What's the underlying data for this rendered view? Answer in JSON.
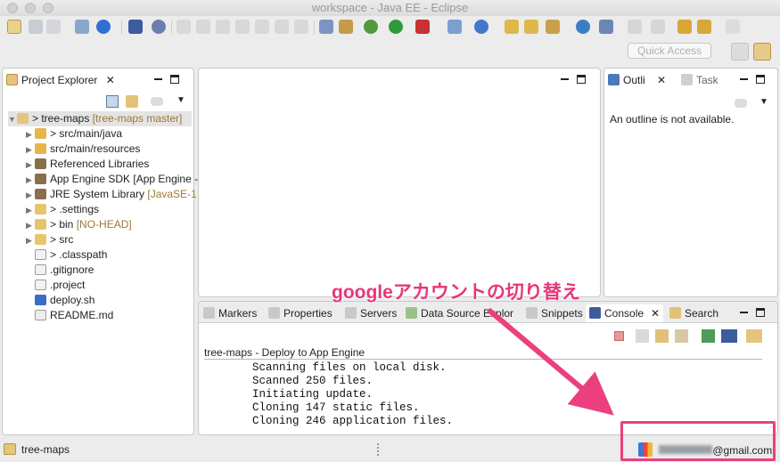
{
  "window": {
    "title": "workspace - Java EE - Eclipse"
  },
  "toolbar": {
    "quick_access_placeholder": "Quick Access"
  },
  "project_explorer": {
    "tab_label": "Project Explorer",
    "tree": [
      {
        "label": "> tree-maps",
        "decoration": " [tree-maps master]",
        "indent": 0,
        "expanded": true,
        "icon": "project-icon"
      },
      {
        "label": "> src/main/java",
        "decoration": "",
        "indent": 1,
        "expanded": false,
        "icon": "source-folder-icon"
      },
      {
        "label": "src/main/resources",
        "decoration": "",
        "indent": 1,
        "expanded": false,
        "icon": "source-folder-icon"
      },
      {
        "label": "Referenced Libraries",
        "decoration": "",
        "indent": 1,
        "expanded": false,
        "icon": "library-icon"
      },
      {
        "label": "App Engine SDK [App Engine -",
        "decoration": "",
        "indent": 1,
        "expanded": false,
        "icon": "library-icon"
      },
      {
        "label": "JRE System Library",
        "decoration": " [JavaSE-1",
        "indent": 1,
        "expanded": false,
        "icon": "library-icon"
      },
      {
        "label": "> .settings",
        "decoration": "",
        "indent": 1,
        "expanded": false,
        "icon": "folder-icon"
      },
      {
        "label": "> bin",
        "decoration": " [NO-HEAD]",
        "indent": 1,
        "expanded": false,
        "icon": "folder-icon"
      },
      {
        "label": "> src",
        "decoration": "",
        "indent": 1,
        "expanded": false,
        "icon": "folder-icon"
      },
      {
        "label": "> .classpath",
        "decoration": "",
        "indent": 1,
        "expanded": null,
        "icon": "file-icon"
      },
      {
        "label": ".gitignore",
        "decoration": "",
        "indent": 1,
        "expanded": null,
        "icon": "file-icon"
      },
      {
        "label": ".project",
        "decoration": "",
        "indent": 1,
        "expanded": null,
        "icon": "file-icon"
      },
      {
        "label": "deploy.sh",
        "decoration": "",
        "indent": 1,
        "expanded": null,
        "icon": "script-icon"
      },
      {
        "label": "README.md",
        "decoration": "",
        "indent": 1,
        "expanded": null,
        "icon": "text-file-icon"
      }
    ]
  },
  "outline": {
    "tabs": [
      {
        "label": "Outli",
        "active": true
      },
      {
        "label": "Task",
        "active": false
      }
    ],
    "message": "An outline is not available."
  },
  "bottom_panel": {
    "tabs": [
      {
        "label": "Markers",
        "active": false
      },
      {
        "label": "Properties",
        "active": false
      },
      {
        "label": "Servers",
        "active": false
      },
      {
        "label": "Data Source Explor",
        "active": false
      },
      {
        "label": "Snippets",
        "active": false
      },
      {
        "label": "Console",
        "active": true
      },
      {
        "label": "Search",
        "active": false
      }
    ],
    "console_title": "tree-maps - Deploy to App Engine",
    "console_lines": [
      "Scanning files on local disk.",
      "Scanned 250 files.",
      "Initiating update.",
      "Cloning 147 static files.",
      "Cloning 246 application files."
    ]
  },
  "status_bar": {
    "project": "tree-maps",
    "account_suffix": "@gmail.com"
  },
  "annotation": {
    "text": "googleアカウントの切り替え",
    "color": "#e8367a"
  }
}
